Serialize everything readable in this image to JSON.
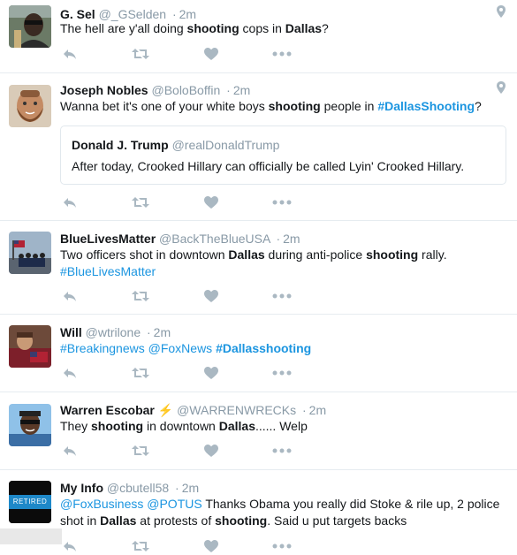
{
  "tweets": [
    {
      "name": "G. Sel",
      "handle": "@_GSelden",
      "dot": "·",
      "time": "2m",
      "text": [
        {
          "t": "The hell are y'all doing "
        },
        {
          "t": "shooting",
          "b": true
        },
        {
          "t": " cops in "
        },
        {
          "t": "Dallas",
          "b": true
        },
        {
          "t": "?"
        }
      ]
    },
    {
      "name": "Joseph Nobles",
      "handle": "@BoloBoffin",
      "dot": "·",
      "time": "2m",
      "text": [
        {
          "t": "Wanna bet it's one of your white boys "
        },
        {
          "t": "shooting",
          "b": true
        },
        {
          "t": " people in "
        },
        {
          "t": "#DallasShooting",
          "b": true,
          "link": true
        },
        {
          "t": "?"
        }
      ],
      "quote": {
        "name": "Donald J. Trump",
        "handle": "@realDonaldTrump",
        "text": "After today, Crooked Hillary can officially be called Lyin' Crooked Hillary."
      }
    },
    {
      "name": "BlueLivesMatter",
      "handle": "@BackTheBlueUSA",
      "dot": "·",
      "time": "2m",
      "text": [
        {
          "t": "Two officers shot in downtown "
        },
        {
          "t": "Dallas",
          "b": true
        },
        {
          "t": " during anti-police "
        },
        {
          "t": "shooting",
          "b": true
        },
        {
          "t": " rally."
        },
        {
          "br": true
        },
        {
          "t": "#BlueLivesMatter",
          "link": true
        }
      ]
    },
    {
      "name": "Will",
      "handle": "@wtrilone",
      "dot": "·",
      "time": "2m",
      "text": [
        {
          "t": "#Breakingnews",
          "link": true
        },
        {
          "t": " "
        },
        {
          "t": "@FoxNews",
          "link": true
        },
        {
          "t": " "
        },
        {
          "t": "#Dallasshooting",
          "b": true,
          "link": true
        }
      ]
    },
    {
      "name": "Warren Escobar",
      "badge": "⚡",
      "handle": "@WARRENWRECKs",
      "dot": "·",
      "time": "2m",
      "text": [
        {
          "t": "They "
        },
        {
          "t": "shooting",
          "b": true
        },
        {
          "t": " in downtown "
        },
        {
          "t": "Dallas",
          "b": true
        },
        {
          "t": "...... Welp"
        }
      ]
    },
    {
      "name": "My Info",
      "handle": "@cbutell58",
      "dot": "·",
      "time": "2m",
      "avatar_text": "RETIRED",
      "text": [
        {
          "t": "@FoxBusiness",
          "link": true
        },
        {
          "t": " "
        },
        {
          "t": "@POTUS",
          "link": true
        },
        {
          "t": " Thanks Obama you really did Stoke & rile up, 2 police shot in "
        },
        {
          "t": "Dallas",
          "b": true
        },
        {
          "t": " at protests of "
        },
        {
          "t": "shooting",
          "b": true
        },
        {
          "t": ". Said u put targets backs"
        }
      ]
    }
  ],
  "colors": {
    "name": "#14171a",
    "meta": "#8899a6",
    "link": "#1b95e0",
    "icon": "#aab8c2",
    "border": "#e6ecf0"
  },
  "icons": [
    "reply-icon",
    "retweet-icon",
    "like-icon",
    "more-icon",
    "geo-pin-icon"
  ]
}
